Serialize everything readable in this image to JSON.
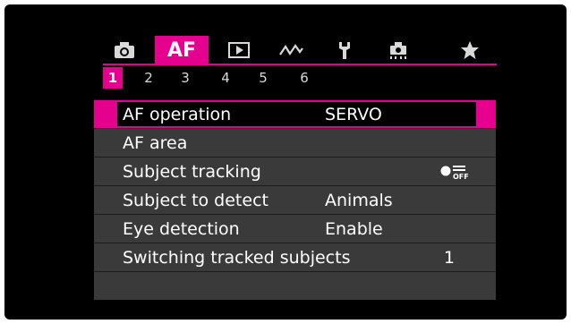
{
  "tabs": [
    {
      "name": "camera",
      "icon": "camera-icon"
    },
    {
      "name": "af",
      "label": "AF",
      "active": true
    },
    {
      "name": "playback",
      "icon": "play-icon"
    },
    {
      "name": "wireless",
      "icon": "wireless-icon"
    },
    {
      "name": "setup",
      "icon": "wrench-icon"
    },
    {
      "name": "custom",
      "icon": "custom-functions-icon"
    },
    {
      "name": "my-menu",
      "icon": "star-icon"
    }
  ],
  "af_tab_label": "AF",
  "pages": [
    "1",
    "2",
    "3",
    "4",
    "5",
    "6"
  ],
  "active_page": "1",
  "menu": {
    "items": [
      {
        "label": "AF operation",
        "value": "SERVO",
        "selected": true
      },
      {
        "label": "AF area",
        "value": ""
      },
      {
        "label": "Subject tracking",
        "value": "",
        "icon": "tracking-off-icon"
      },
      {
        "label": "Subject to detect",
        "value": "Animals"
      },
      {
        "label": "Eye detection",
        "value": "Enable"
      },
      {
        "label": "Switching tracked subjects",
        "value": "1"
      }
    ],
    "off_icon_text": "OFF"
  },
  "colors": {
    "accent": "#e6008e",
    "background": "#000000",
    "row": "#3a3a3a",
    "text": "#ffffff"
  }
}
